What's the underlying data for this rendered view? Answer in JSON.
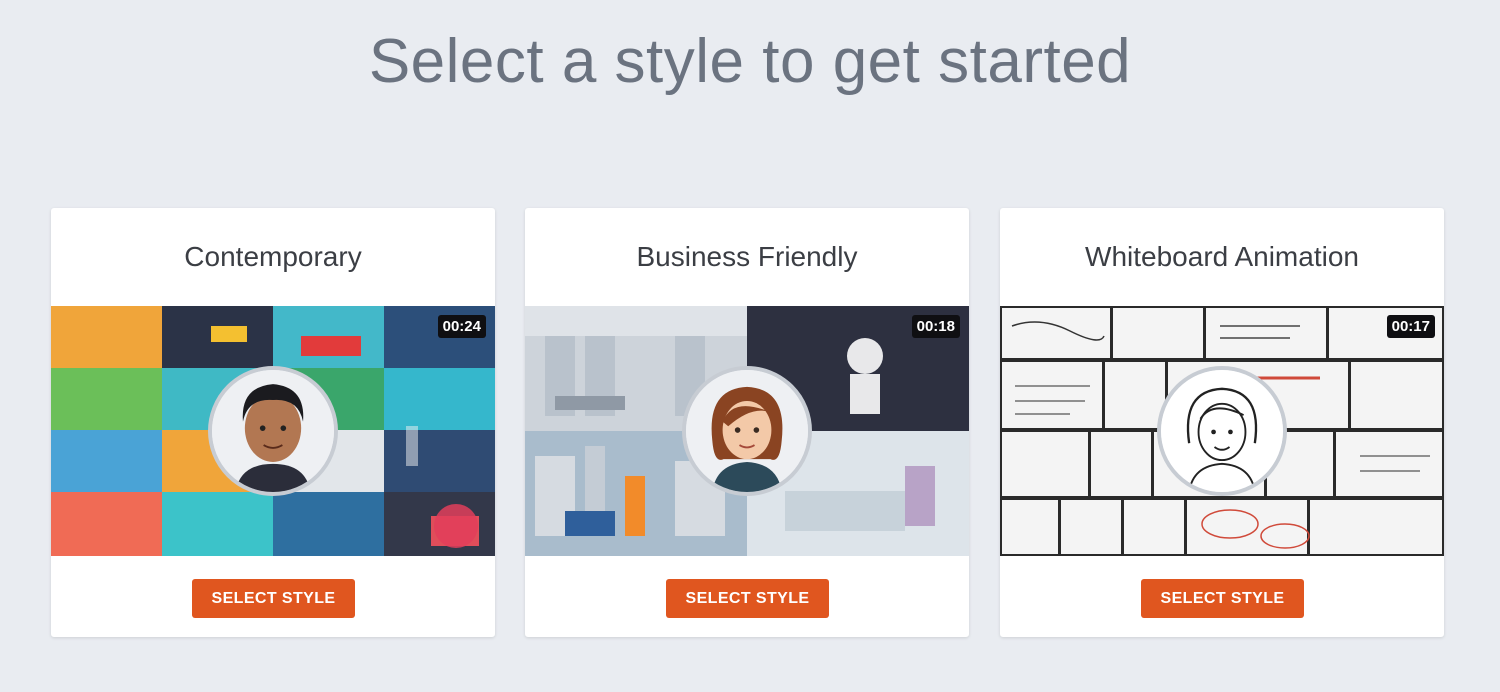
{
  "heading": "Select a style to get started",
  "cards": [
    {
      "title": "Contemporary",
      "duration": "00:24",
      "button": "SELECT STYLE"
    },
    {
      "title": "Business Friendly",
      "duration": "00:18",
      "button": "SELECT STYLE"
    },
    {
      "title": "Whiteboard Animation",
      "duration": "00:17",
      "button": "SELECT STYLE"
    }
  ],
  "colors": {
    "background": "#e9ecf1",
    "accent": "#e0561f",
    "heading": "#6b7380"
  },
  "icons": [
    "play-duration-badge",
    "character-avatar-icon"
  ]
}
